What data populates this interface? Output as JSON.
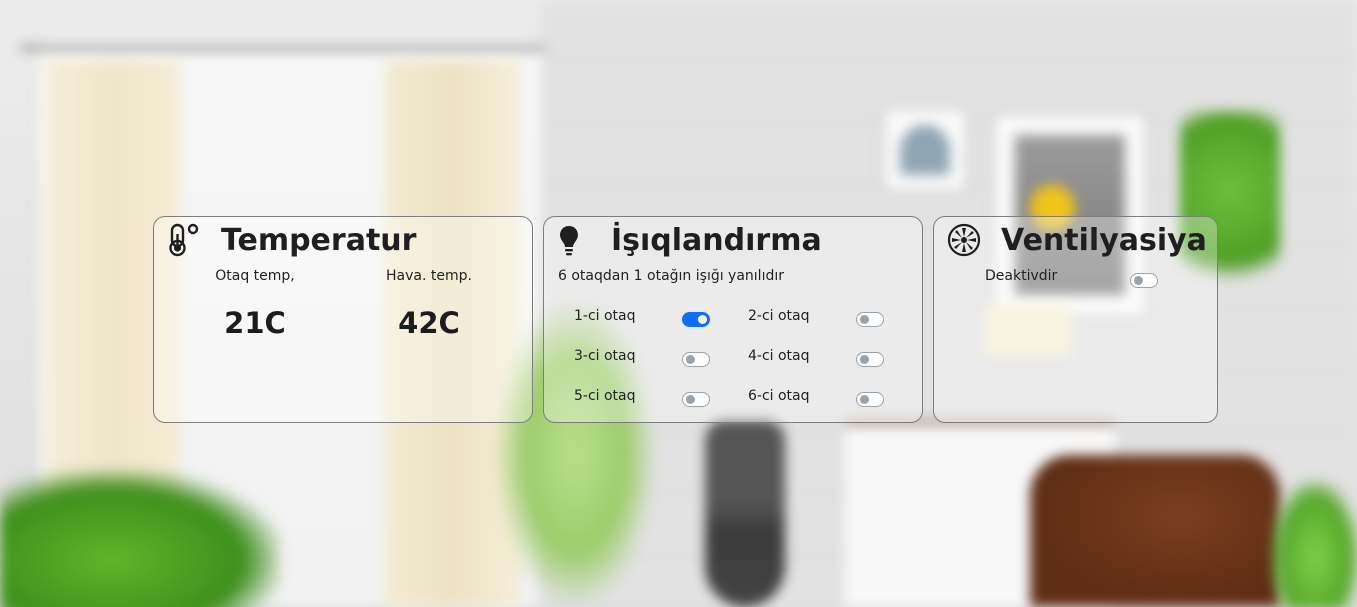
{
  "temperature": {
    "title": "Temperatur",
    "icon": "thermometer-icon",
    "room_label": "Otaq temp,",
    "room_value": "21C",
    "outdoor_label": "Hava. temp.",
    "outdoor_value": "42C"
  },
  "lighting": {
    "title": "İşıqlandırma",
    "icon": "lightbulb-icon",
    "status": "6 otaqdan 1 otağın işığı yanılıdır",
    "rooms": [
      {
        "label": "1-ci otaq",
        "on": true
      },
      {
        "label": "2-ci otaq",
        "on": false
      },
      {
        "label": "3-ci otaq",
        "on": false
      },
      {
        "label": "4-ci otaq",
        "on": false
      },
      {
        "label": "5-ci otaq",
        "on": false
      },
      {
        "label": "6-ci otaq",
        "on": false
      }
    ]
  },
  "ventilation": {
    "title": "Ventilyasiya",
    "icon": "fan-icon",
    "status": "Deaktivdir",
    "on": false
  },
  "colors": {
    "switch_on": "#0d6efd",
    "switch_off": "#9aa3ab",
    "card_border": "#7d7d7d"
  }
}
